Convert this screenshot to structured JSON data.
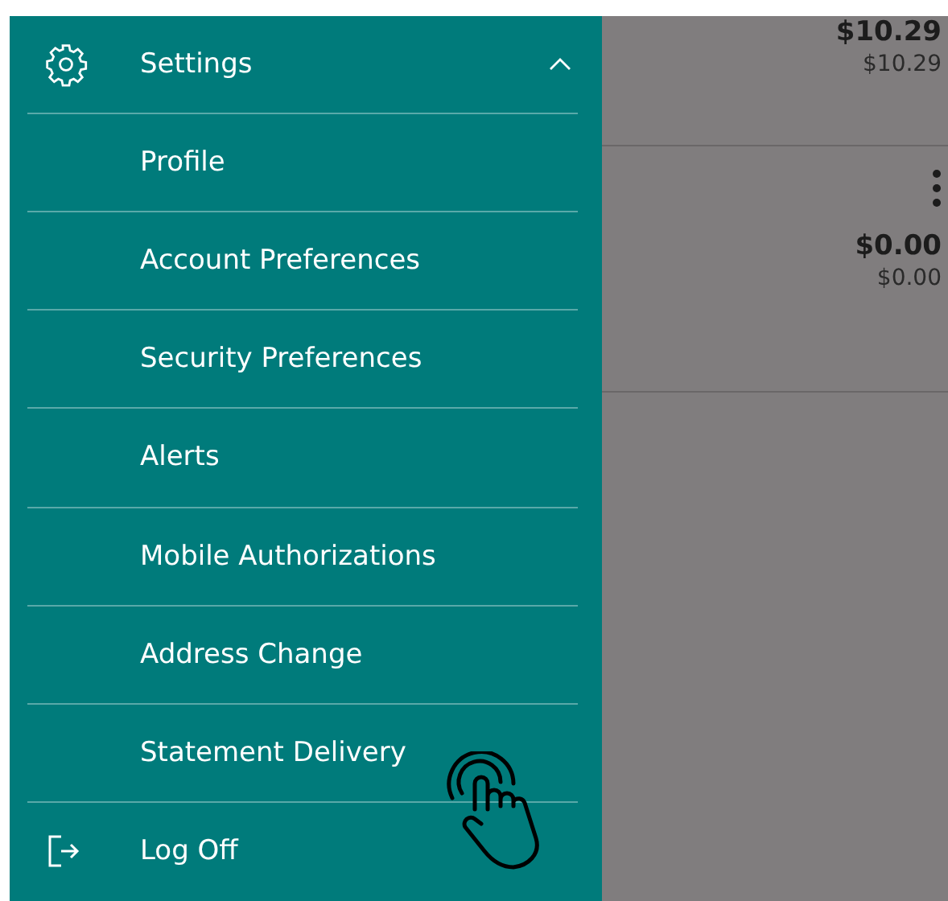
{
  "menu": {
    "header": {
      "label": "Settings",
      "expanded": true
    },
    "items": [
      {
        "label": "Profile"
      },
      {
        "label": "Account Preferences"
      },
      {
        "label": "Security Preferences"
      },
      {
        "label": "Alerts"
      },
      {
        "label": "Mobile Authorizations"
      },
      {
        "label": "Address Change"
      },
      {
        "label": "Statement Delivery"
      }
    ],
    "footer": {
      "label": "Log Off"
    }
  },
  "accounts": [
    {
      "balance": "$10.29",
      "available": "$10.29",
      "has_menu": false
    },
    {
      "balance": "$0.00",
      "available": "$0.00",
      "has_menu": true
    }
  ]
}
